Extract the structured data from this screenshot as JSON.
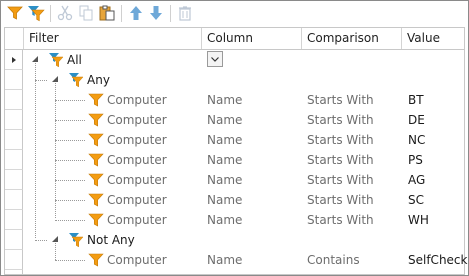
{
  "toolbar": {
    "buttons": [
      {
        "name": "add-filter-button",
        "icon": "funnel-icon"
      },
      {
        "name": "add-group-button",
        "icon": "funnel-group-icon"
      },
      {
        "name": "cut-button",
        "icon": "scissors-icon"
      },
      {
        "name": "copy-button",
        "icon": "copy-icon"
      },
      {
        "name": "paste-button",
        "icon": "paste-icon"
      },
      {
        "name": "move-up-button",
        "icon": "arrow-up-icon"
      },
      {
        "name": "move-down-button",
        "icon": "arrow-down-icon"
      },
      {
        "name": "delete-button",
        "icon": "trash-icon"
      }
    ]
  },
  "grid": {
    "columns": [
      "Filter",
      "Column",
      "Comparison",
      "Value"
    ],
    "root": {
      "label": "All"
    },
    "groups": [
      {
        "label": "Any",
        "rows": [
          {
            "filter": "Computer",
            "column": "Name",
            "comparison": "Starts With",
            "value": "BT"
          },
          {
            "filter": "Computer",
            "column": "Name",
            "comparison": "Starts With",
            "value": "DE"
          },
          {
            "filter": "Computer",
            "column": "Name",
            "comparison": "Starts With",
            "value": "NC"
          },
          {
            "filter": "Computer",
            "column": "Name",
            "comparison": "Starts With",
            "value": "PS"
          },
          {
            "filter": "Computer",
            "column": "Name",
            "comparison": "Starts With",
            "value": "AG"
          },
          {
            "filter": "Computer",
            "column": "Name",
            "comparison": "Starts With",
            "value": "SC"
          },
          {
            "filter": "Computer",
            "column": "Name",
            "comparison": "Starts With",
            "value": "WH"
          }
        ]
      },
      {
        "label": "Not Any",
        "rows": [
          {
            "filter": "Computer",
            "column": "Name",
            "comparison": "Contains",
            "value": "SelfCheck"
          }
        ]
      }
    ]
  },
  "colors": {
    "funnel": "#f39c12",
    "funnel_group": "#2a8fc7",
    "disabled_icon": "#bfc9d6",
    "arrow": "#6ea8d8"
  }
}
